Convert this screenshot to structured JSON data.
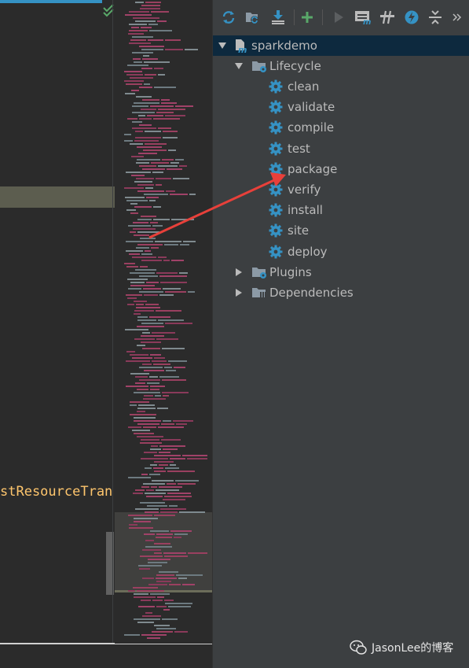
{
  "maven_panel": {
    "toolbar": [
      {
        "name": "reimport-icon",
        "color": "#3592c4"
      },
      {
        "name": "generate-sources-icon",
        "color": "#3592c4"
      },
      {
        "name": "download-icon",
        "color": "#3592c4"
      },
      {
        "name": "add-project-icon",
        "color": "#59a869"
      },
      {
        "name": "run-icon",
        "color": "#6e6e6e"
      },
      {
        "name": "execute-goal-icon",
        "color": "#3592c4"
      },
      {
        "name": "toggle-offline-icon",
        "color": "#3592c4"
      },
      {
        "name": "skip-tests-icon",
        "color": "#3592c4"
      },
      {
        "name": "collapse-all-icon",
        "color": "#bbbbbb"
      },
      {
        "name": "more-icon",
        "color": "#bbbbbb"
      }
    ],
    "project": "sparkdemo",
    "lifecycle": {
      "label": "Lifecycle",
      "goals": [
        "clean",
        "validate",
        "compile",
        "test",
        "package",
        "verify",
        "install",
        "site",
        "deploy"
      ]
    },
    "plugins": "Plugins",
    "dependencies": "Dependencies"
  },
  "editor": {
    "code_fragment": "stResourceTran"
  },
  "watermark": "JasonLee的博客",
  "colors": {
    "panel_bg": "#3c3f41",
    "editor_bg": "#2b2b2b",
    "selection": "#0d293e",
    "gear_blue": "#3592c4",
    "annotation_red": "#e8403a"
  }
}
